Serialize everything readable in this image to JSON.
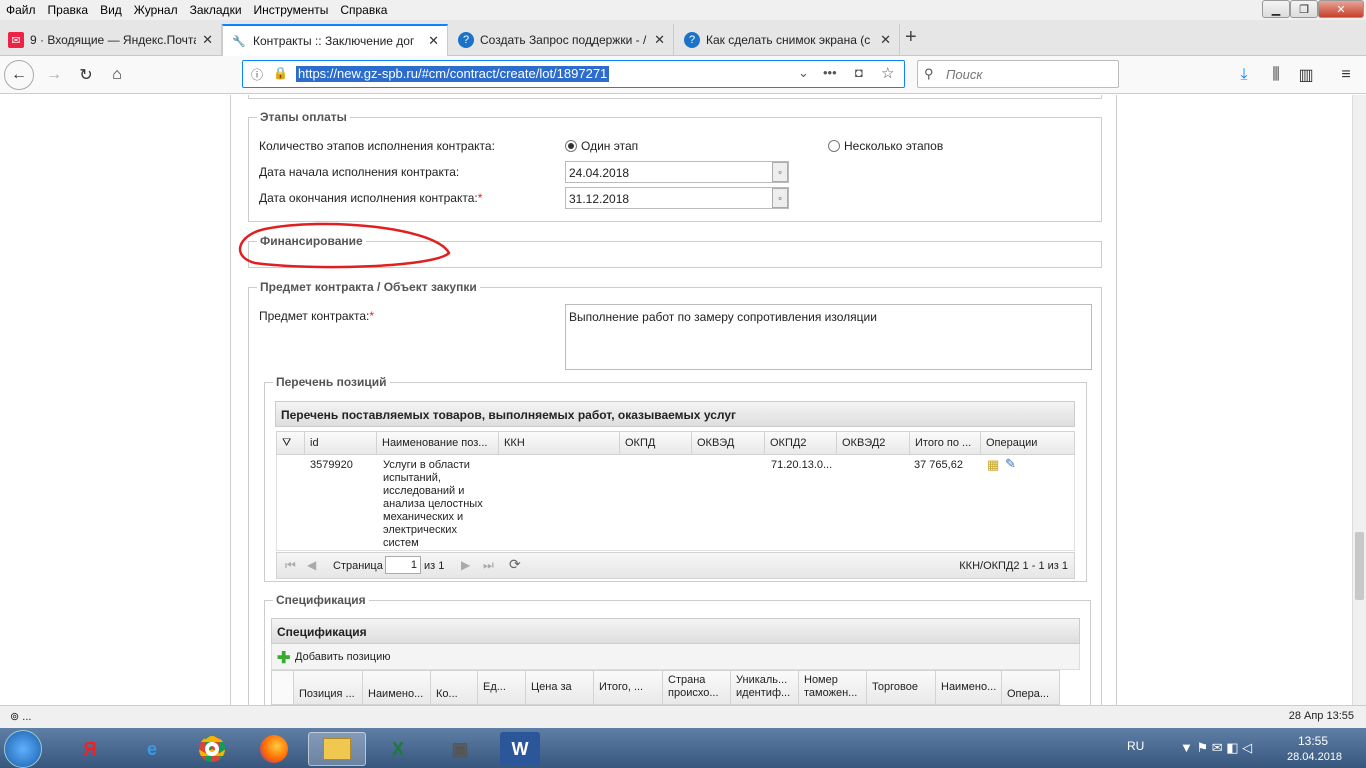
{
  "menu": [
    "Файл",
    "Правка",
    "Вид",
    "Журнал",
    "Закладки",
    "Инструменты",
    "Справка"
  ],
  "tabs": [
    {
      "title": "9 · Входящие — Яндекс.Почта",
      "icon": "mail-icon"
    },
    {
      "title": "Контракты :: Заключение дог",
      "icon": "wrench-icon"
    },
    {
      "title": "Создать Запрос поддержки - /",
      "icon": "help-icon"
    },
    {
      "title": "Как сделать снимок экрана (с",
      "icon": "help-icon"
    }
  ],
  "nav": {
    "url": "https://new.gz-spb.ru/#cm/contract/create/lot/1897271",
    "search_placeholder": "Поиск"
  },
  "stages": {
    "legend": "Этапы оплаты",
    "count_label": "Количество этапов исполнения контракта:",
    "option_one": "Один этап",
    "option_many": "Несколько этапов",
    "start_label": "Дата начала исполнения контракта:",
    "start_value": "24.04.2018",
    "end_label": "Дата окончания исполнения контракта:",
    "end_value": "31.12.2018",
    "req": "*"
  },
  "financing": {
    "legend": "Финансирование"
  },
  "subject": {
    "legend": "Предмет контракта / Объект закупки",
    "label": "Предмет контракта:",
    "value": "Выполнение работ по замеру сопротивления изоляции",
    "req": "*"
  },
  "positions": {
    "legend": "Перечень позиций",
    "grid_title": "Перечень поставляемых товаров, выполняемых работ, оказываемых услуг",
    "columns": [
      "id",
      "Наименование поз...",
      "ККН",
      "ОКПД",
      "ОКВЭД",
      "ОКПД2",
      "ОКВЭД2",
      "Итого по ...",
      "Операции"
    ],
    "row": {
      "id": "3579920",
      "name": "Услуги в области испытаний, исследований и анализа целостных механических и электрических систем",
      "okpd2": "71.20.13.0...",
      "total": "37 765,62"
    },
    "pager": {
      "page_label": "Страница",
      "page": "1",
      "of": "из 1",
      "summary": "ККН/ОКПД2 1 - 1 из 1"
    }
  },
  "spec": {
    "legend": "Спецификация",
    "grid_title": "Спецификация",
    "add": "Добавить позицию",
    "columns": [
      "Позиция ...",
      "Наимено...",
      "Ко...",
      "Ед...",
      "Цена за",
      "Итого, ...",
      "Страна происхо...",
      "Уникаль... идентиф...",
      "Номер таможен...",
      "Торговое",
      "Наимено...",
      "Опера..."
    ]
  },
  "status": {
    "left": "⊚ ...",
    "right": "28 Апр 13:55"
  },
  "taskbar": {
    "lang": "RU",
    "time": "13:55",
    "date": "28.04.2018"
  },
  "colors": {
    "accent": "#0a84ff",
    "annotation": "#e02020"
  }
}
